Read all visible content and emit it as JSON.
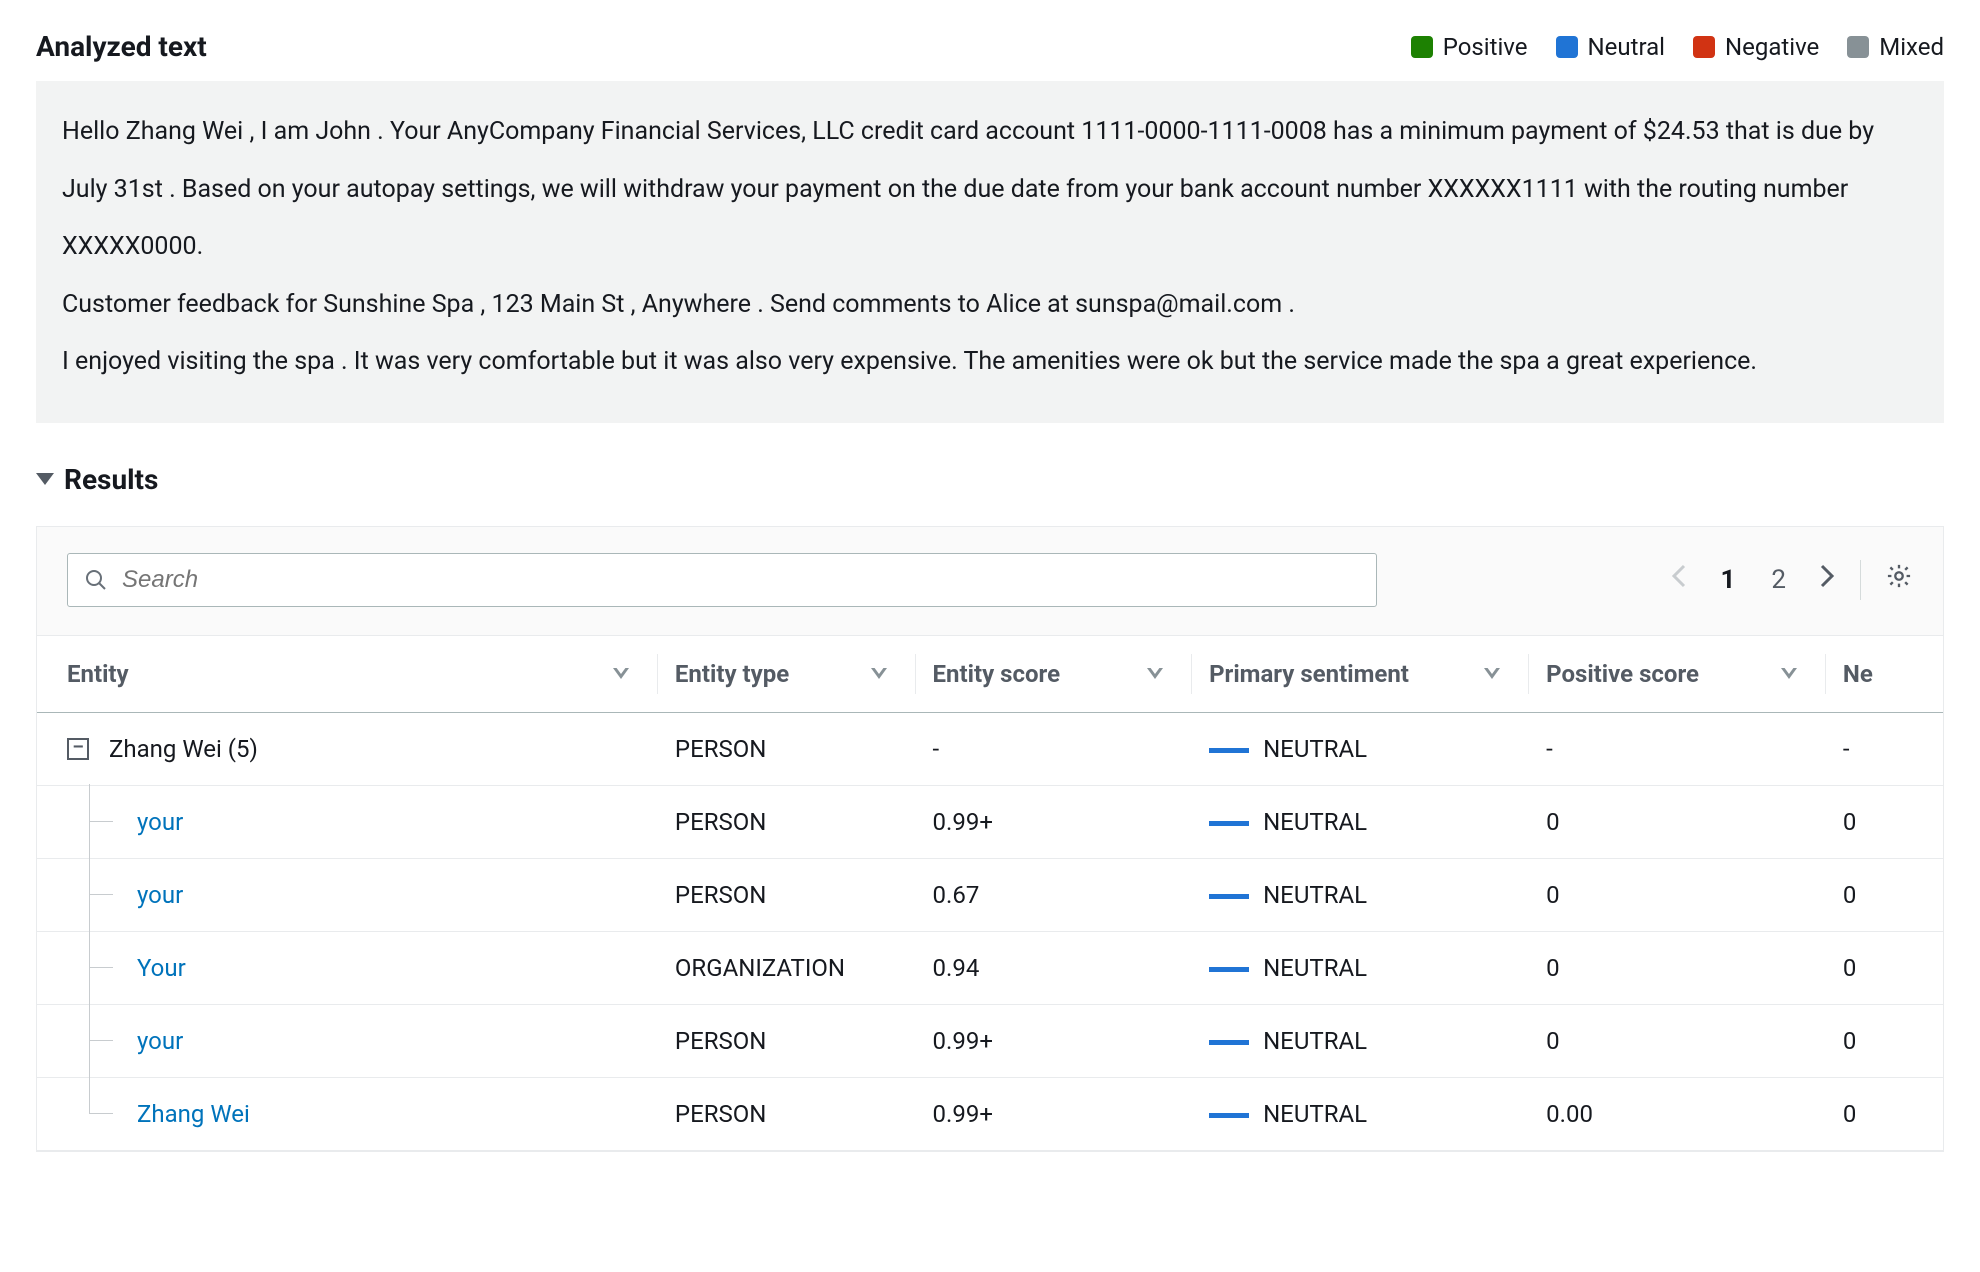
{
  "header": {
    "title": "Analyzed text",
    "legend": {
      "positive": "Positive",
      "neutral": "Neutral",
      "negative": "Negative",
      "mixed": "Mixed"
    }
  },
  "analyzed_text": {
    "tokens": [
      {
        "t": "Hello "
      },
      {
        "t": "Zhang Wei",
        "u": "blue"
      },
      {
        "t": " , "
      },
      {
        "t": "I",
        "u": "ltblue"
      },
      {
        "t": " am "
      },
      {
        "t": "John",
        "u": "ltblue"
      },
      {
        "t": " . "
      },
      {
        "t": "Your",
        "u": "blue"
      },
      {
        "t": "  "
      },
      {
        "t": "AnyCompany Financial Services, LLC",
        "u": "ltblue"
      },
      {
        "t": "  "
      },
      {
        "t": "credit card account",
        "u": "ltblue"
      },
      {
        "t": "  "
      },
      {
        "t": "1111-0000-1111-0008 has a minimum payment of "
      },
      {
        "t": "$24.53",
        "u": "ltblue"
      },
      {
        "t": "  that is due "
      },
      {
        "t": "by July 31st",
        "u": "blue"
      },
      {
        "t": " . Based on "
      },
      {
        "t": "your",
        "u": "blue"
      },
      {
        "t": "  autopay settings, "
      },
      {
        "t": "we",
        "u": "ltblue"
      },
      {
        "t": "  will withdraw "
      },
      {
        "t": "your",
        "u": "blue"
      },
      {
        "t": "  payment "
      },
      {
        "t": "on",
        "u": "ltblue"
      },
      {
        "t": "  the due "
      },
      {
        "t": "date",
        "u": "ltblue"
      },
      {
        "t": "  from "
      },
      {
        "t": "your",
        "u": "blue"
      },
      {
        "t": "  "
      },
      {
        "t": "bank account",
        "u": "ltblue"
      },
      {
        "t": "  number "
      },
      {
        "t": "XXXXXX1111",
        "u": "ltblue"
      },
      {
        "t": "  with the routing number XXXXX0000."
      },
      {
        "t": "\n"
      },
      {
        "t": "Customer",
        "u": "ltblue"
      },
      {
        "t": "  feedback for "
      },
      {
        "t": "Sunshine Spa",
        "u": "ltblue"
      },
      {
        "t": " , "
      },
      {
        "t": "123 Main St",
        "u": "ltblue"
      },
      {
        "t": " , "
      },
      {
        "t": "Anywhere",
        "u": "ltblue"
      },
      {
        "t": " . Send comments to "
      },
      {
        "t": "Alice",
        "u": "ltblue"
      },
      {
        "t": "  at "
      },
      {
        "t": "sunspa@mail.com",
        "u": "ltblue"
      },
      {
        "t": " ."
      },
      {
        "t": "\n"
      },
      {
        "t": "I",
        "u": "ltblue"
      },
      {
        "t": "  "
      },
      {
        "t": "enjoyed visiting the",
        "u": "green"
      },
      {
        "t": " "
      },
      {
        "t": "spa",
        "u": "green"
      },
      {
        "t": " . "
      },
      {
        "t": "It",
        "u": "green"
      },
      {
        "t": "  was very comfortable but "
      },
      {
        "t": "it",
        "u": "red"
      },
      {
        "t": "  was also very expensive. The amenities were ok but the "
      },
      {
        "t": "service",
        "u": "ltblue"
      },
      {
        "t": "  made the "
      },
      {
        "t": "spa",
        "u": "green"
      },
      {
        "t": "  a great experience."
      }
    ]
  },
  "results": {
    "title": "Results",
    "search": {
      "placeholder": "Search"
    },
    "pager": {
      "page1": "1",
      "page2": "2"
    },
    "columns": {
      "entity": "Entity",
      "type": "Entity type",
      "score": "Entity score",
      "sentiment": "Primary sentiment",
      "positive": "Positive score",
      "negative_trunc": "Ne"
    },
    "rows": [
      {
        "kind": "group",
        "entity": "Zhang Wei (5)",
        "type": "PERSON",
        "score": "-",
        "sentiment": "NEUTRAL",
        "pos": "-",
        "neg": "-"
      },
      {
        "kind": "child",
        "entity": "your",
        "type": "PERSON",
        "score": "0.99+",
        "sentiment": "NEUTRAL",
        "pos": "0",
        "neg": "0"
      },
      {
        "kind": "child",
        "entity": "your",
        "type": "PERSON",
        "score": "0.67",
        "sentiment": "NEUTRAL",
        "pos": "0",
        "neg": "0"
      },
      {
        "kind": "child",
        "entity": "Your",
        "type": "ORGANIZATION",
        "score": "0.94",
        "sentiment": "NEUTRAL",
        "pos": "0",
        "neg": "0"
      },
      {
        "kind": "child",
        "entity": "your",
        "type": "PERSON",
        "score": "0.99+",
        "sentiment": "NEUTRAL",
        "pos": "0",
        "neg": "0"
      },
      {
        "kind": "child",
        "entity": "Zhang Wei",
        "type": "PERSON",
        "score": "0.99+",
        "sentiment": "NEUTRAL",
        "pos": "0.00",
        "neg": "0"
      }
    ]
  }
}
